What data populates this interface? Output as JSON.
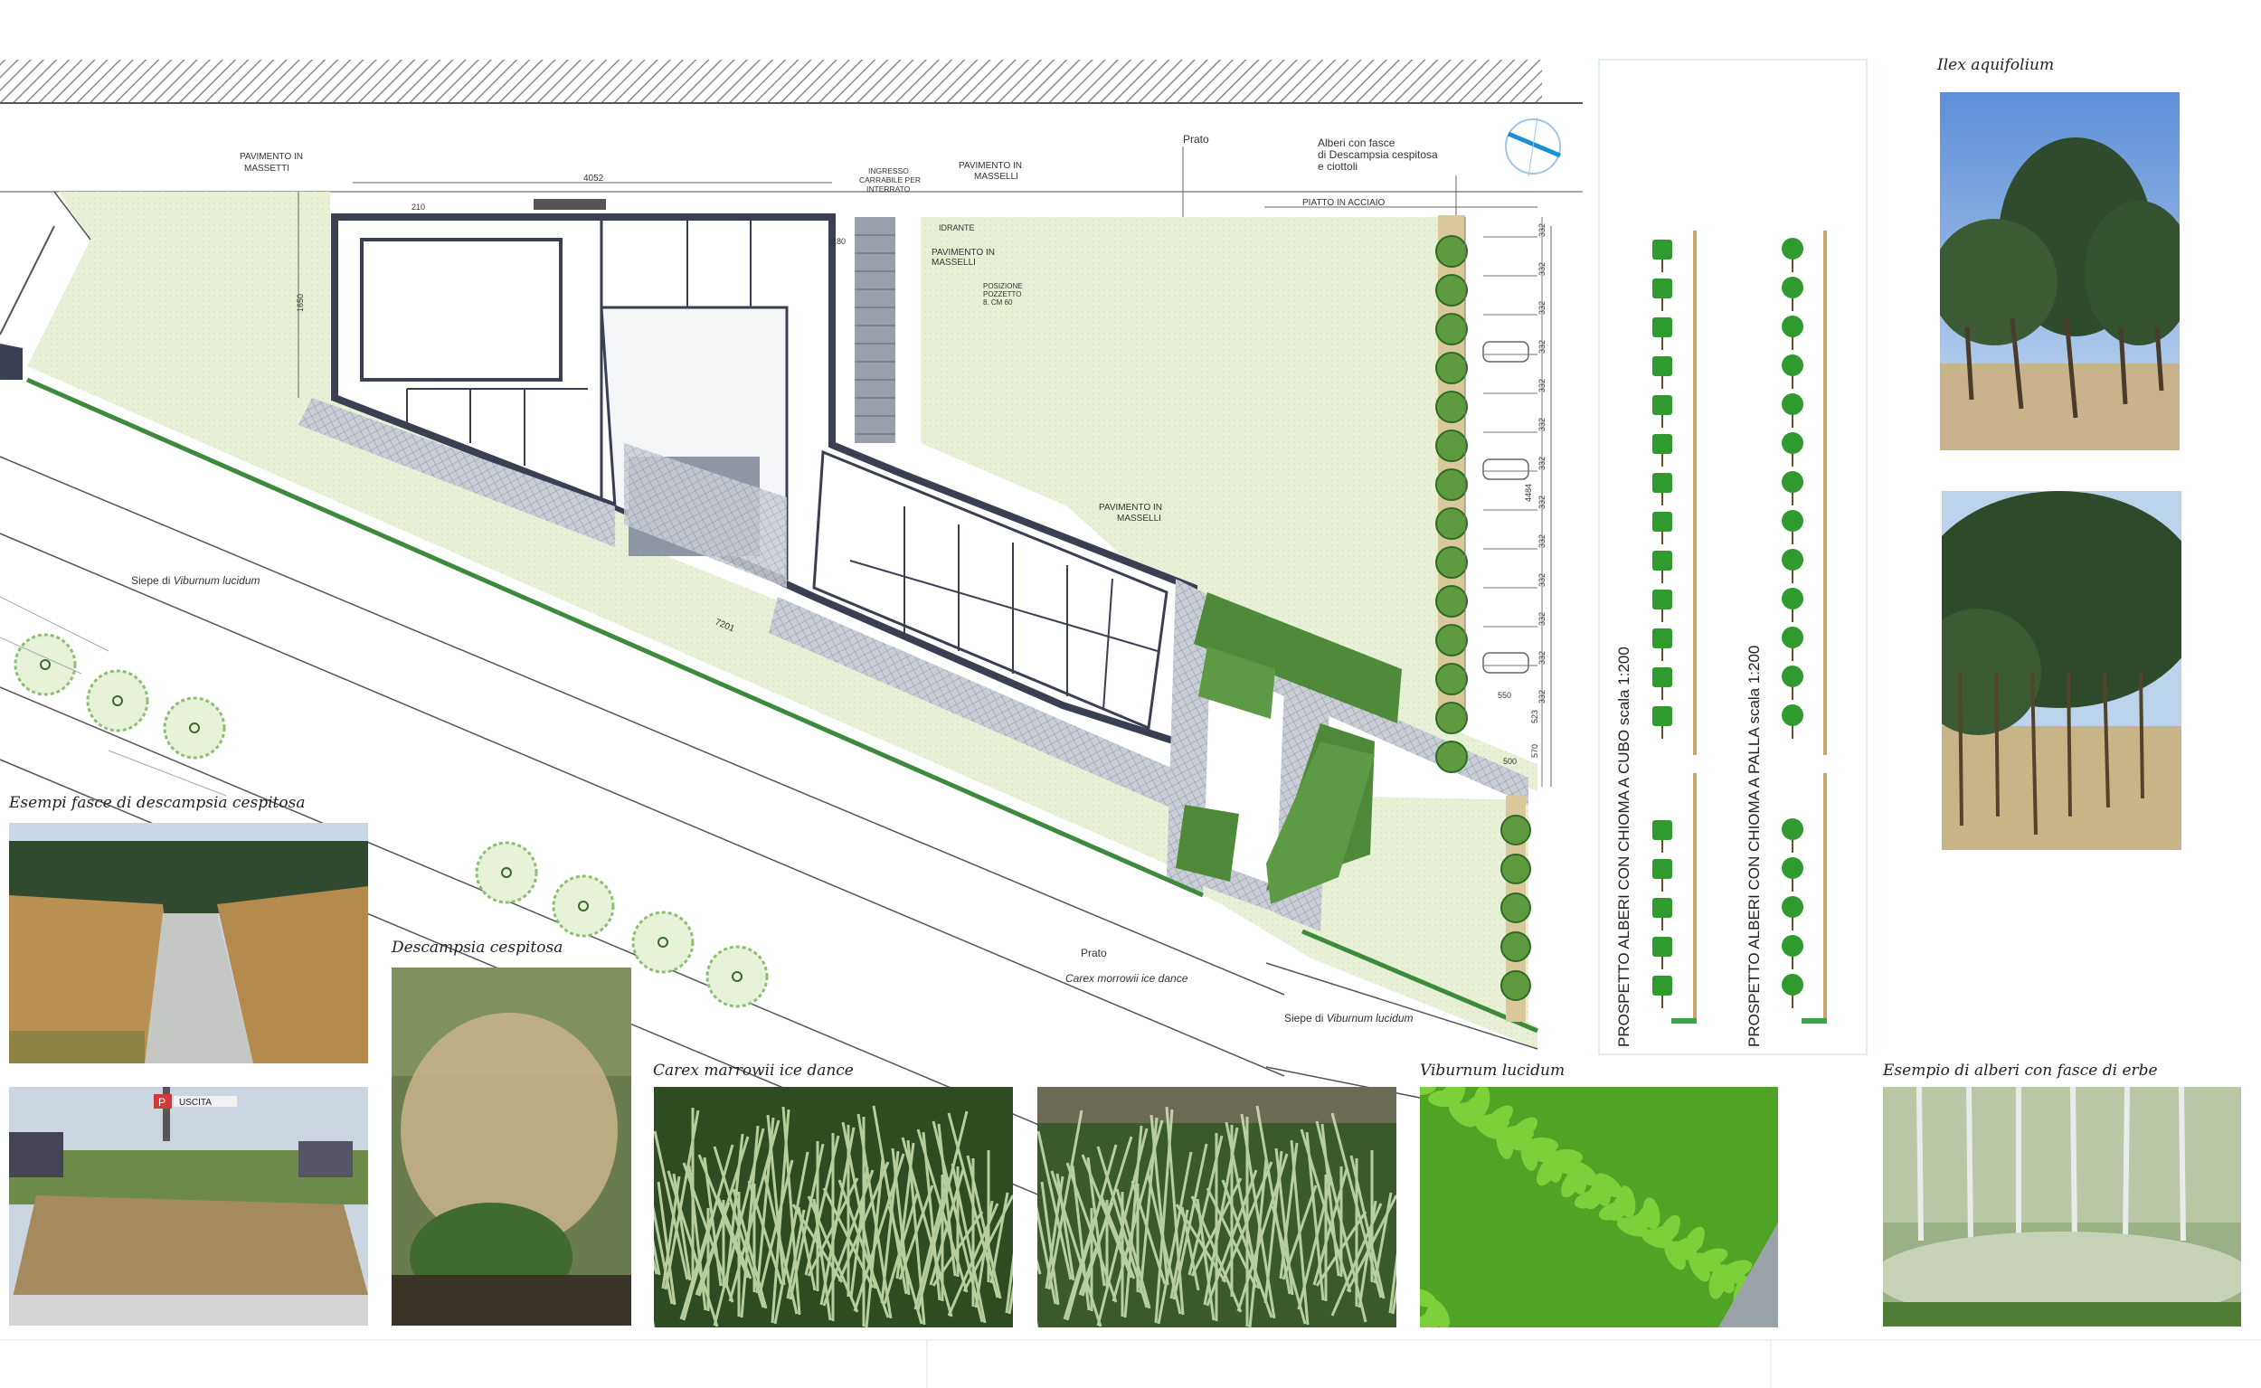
{
  "plan": {
    "labels": {
      "pav_masseti": [
        "PAVIMENTO IN",
        "MASSETTI"
      ],
      "pav_masselli_top": [
        "PAVIMENTO IN",
        "MASSELLI"
      ],
      "pav_masselli_2": [
        "PAVIMENTO IN",
        "MASSELLI"
      ],
      "pav_masselli_3": [
        "PAVIMENTO IN",
        "MASSELLI"
      ],
      "ingresso": [
        "INGRESSO",
        "CARRABILE PER",
        "INTERRATO"
      ],
      "prato_top": "Prato",
      "prato_bottom": "Prato",
      "alberi_fasce": [
        "Alberi con fasce",
        "di Descampsia cespitosa",
        "e ciottoli"
      ],
      "piatto": "PIATTO IN ACCIAIO",
      "idrante": "IDRANTE",
      "posizione": [
        "POSIZIONE",
        "POZZETTO",
        "8. CM 60"
      ],
      "siepe_left_prefix": "Siepe di ",
      "siepe_left_species": "Viburnum lucidum",
      "siepe_right_prefix": "Siepe di ",
      "siepe_right_species": "Viburnum lucidum",
      "carex_label": "Carex morrowii ice dance"
    },
    "dimensions": {
      "d4052": "4052",
      "d210": "210",
      "d180": "180",
      "d7201": "7201",
      "d1650": "1650",
      "d332": "332",
      "d4464": "4484",
      "d550": "550",
      "d523": "523",
      "d570": "570",
      "d500": "500"
    }
  },
  "elevations": {
    "cubo_title": "PROSPETTO ALBERI CON CHIOMA A CUBO scala 1:200",
    "palla_title": "PROSPETTO ALBERI CON CHIOMA A PALLA scala 1:200"
  },
  "captions": {
    "ilex": "Ilex aquifolium",
    "esempi_fasce": "Esempi fasce di descampsia cespitosa",
    "descampsia": "Descampsia cespitosa",
    "carex": "Carex marrowii ice dance",
    "viburnum": "Viburnum lucidum",
    "esempio_alberi": "Esempio di alberi con fasce di erbe"
  },
  "photo_signs": {
    "parking": "P",
    "uscita": "USCITA"
  },
  "colors": {
    "lawn": "#e6f0d2",
    "dark_grass": "#4e8a3a",
    "tree_green": "#2f8c2f",
    "wall": "#3a3f52",
    "paving": "#c8ccd2"
  }
}
